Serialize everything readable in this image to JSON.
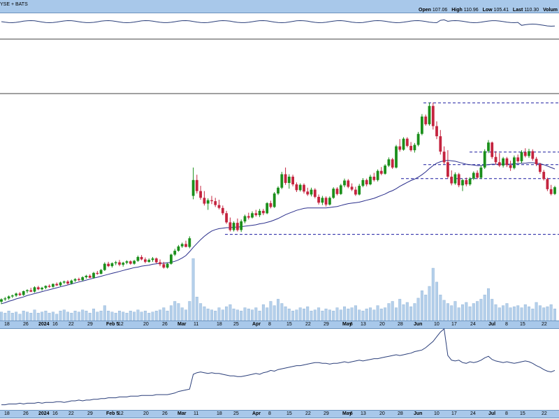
{
  "header": {
    "source": "YSE + BATS",
    "open_label": "Open",
    "open": "107.06",
    "high_label": "High",
    "high": "110.96",
    "low_label": "Low",
    "low": "105.41",
    "last_label": "Last",
    "last": "110.30",
    "volume_label": "Volum"
  },
  "axis_labels": [
    "18",
    "26",
    "2024",
    "16",
    "22",
    "29",
    "Feb 5",
    "12",
    "20",
    "26",
    "Mar",
    "11",
    "18",
    "25",
    "Apr",
    "8",
    "15",
    "22",
    "29",
    "May",
    "6",
    "13",
    "20",
    "28",
    "Jun",
    "10",
    "17",
    "24",
    "Jul",
    "8",
    "15",
    "22"
  ],
  "colors": {
    "up": "#1b8f1b",
    "down": "#c4243f",
    "sma": "#2b2f8c",
    "volume": "#b4cfea",
    "dashed": "#1a1aa0",
    "header": "#a8c8ea",
    "indicator": "#2b3f7a"
  },
  "chart_data": {
    "type": "candlestick",
    "ohlc_order": [
      "open",
      "high",
      "low",
      "close"
    ],
    "candles": [
      [
        69.6,
        70.3,
        69.1,
        70.1
      ],
      [
        70.1,
        70.6,
        69.8,
        70.3
      ],
      [
        70.3,
        70.9,
        70.0,
        70.7
      ],
      [
        70.7,
        71.1,
        70.4,
        70.9
      ],
      [
        70.9,
        71.5,
        70.6,
        71.3
      ],
      [
        71.3,
        71.6,
        70.8,
        71.0
      ],
      [
        71.0,
        71.9,
        70.8,
        71.8
      ],
      [
        71.8,
        72.2,
        71.4,
        72.0
      ],
      [
        72.0,
        72.5,
        71.6,
        71.7
      ],
      [
        71.7,
        72.8,
        71.5,
        72.6
      ],
      [
        72.6,
        72.9,
        72.0,
        72.2
      ],
      [
        72.2,
        72.7,
        71.9,
        72.5
      ],
      [
        72.5,
        73.0,
        72.2,
        72.9
      ],
      [
        72.9,
        73.2,
        72.5,
        72.7
      ],
      [
        72.7,
        73.4,
        72.5,
        73.3
      ],
      [
        73.3,
        73.6,
        72.9,
        73.0
      ],
      [
        73.0,
        73.8,
        72.8,
        73.6
      ],
      [
        73.6,
        74.0,
        73.3,
        73.8
      ],
      [
        73.8,
        74.1,
        73.1,
        73.4
      ],
      [
        73.4,
        74.2,
        73.2,
        74.0
      ],
      [
        74.0,
        74.5,
        73.7,
        74.3
      ],
      [
        74.3,
        74.6,
        73.9,
        74.1
      ],
      [
        74.1,
        74.9,
        73.9,
        74.7
      ],
      [
        74.7,
        75.2,
        74.4,
        75.0
      ],
      [
        75.0,
        75.3,
        74.5,
        74.6
      ],
      [
        74.6,
        75.8,
        74.4,
        75.6
      ],
      [
        75.6,
        76.0,
        75.2,
        75.4
      ],
      [
        75.4,
        76.4,
        75.3,
        76.2
      ],
      [
        76.2,
        77.8,
        76.0,
        77.5
      ],
      [
        77.5,
        77.9,
        76.8,
        77.0
      ],
      [
        77.0,
        77.8,
        76.7,
        77.6
      ],
      [
        77.6,
        78.1,
        77.2,
        77.8
      ],
      [
        77.8,
        78.3,
        77.0,
        77.3
      ],
      [
        77.3,
        77.9,
        76.9,
        77.7
      ],
      [
        77.7,
        78.2,
        77.4,
        78.0
      ],
      [
        78.0,
        78.2,
        77.3,
        77.5
      ],
      [
        77.5,
        78.3,
        77.3,
        78.1
      ],
      [
        78.1,
        79.2,
        77.9,
        78.9
      ],
      [
        78.9,
        79.3,
        78.2,
        78.4
      ],
      [
        78.4,
        78.8,
        77.6,
        77.9
      ],
      [
        77.9,
        78.6,
        77.7,
        78.3
      ],
      [
        78.3,
        78.9,
        77.9,
        78.6
      ],
      [
        78.6,
        78.8,
        77.6,
        77.8
      ],
      [
        77.8,
        78.4,
        77.0,
        77.4
      ],
      [
        77.4,
        77.9,
        76.5,
        76.7
      ],
      [
        76.7,
        77.7,
        76.5,
        77.5
      ],
      [
        77.5,
        79.6,
        77.3,
        79.4
      ],
      [
        79.4,
        80.6,
        79.1,
        80.2
      ],
      [
        80.2,
        81.4,
        80.0,
        81.1
      ],
      [
        81.1,
        81.9,
        80.8,
        81.6
      ],
      [
        81.6,
        82.3,
        80.9,
        81.0
      ],
      [
        81.0,
        83.2,
        80.7,
        82.8
      ],
      [
        91.6,
        97.5,
        90.9,
        94.9
      ],
      [
        94.9,
        96.0,
        92.1,
        92.6
      ],
      [
        92.6,
        93.7,
        90.8,
        91.2
      ],
      [
        91.2,
        92.6,
        89.6,
        90.0
      ],
      [
        90.0,
        91.1,
        88.7,
        90.7
      ],
      [
        90.7,
        91.6,
        89.9,
        90.5
      ],
      [
        90.5,
        91.2,
        89.3,
        89.7
      ],
      [
        89.7,
        90.8,
        88.8,
        89.1
      ],
      [
        89.1,
        89.6,
        87.6,
        88.0
      ],
      [
        88.0,
        88.5,
        85.8,
        86.1
      ],
      [
        86.1,
        87.1,
        84.2,
        84.5
      ],
      [
        84.5,
        86.3,
        84.2,
        86.0
      ],
      [
        86.0,
        86.9,
        84.2,
        84.5
      ],
      [
        84.5,
        86.7,
        84.1,
        86.3
      ],
      [
        86.3,
        87.7,
        85.9,
        87.4
      ],
      [
        87.4,
        88.1,
        86.7,
        87.1
      ],
      [
        87.1,
        88.4,
        86.9,
        88.0
      ],
      [
        88.0,
        88.7,
        87.3,
        87.6
      ],
      [
        87.6,
        88.9,
        87.2,
        88.5
      ],
      [
        88.5,
        88.9,
        87.6,
        88.0
      ],
      [
        88.0,
        90.3,
        87.8,
        90.1
      ],
      [
        90.1,
        90.6,
        89.0,
        89.3
      ],
      [
        89.3,
        92.4,
        89.1,
        92.1
      ],
      [
        92.1,
        93.6,
        91.8,
        93.3
      ],
      [
        93.3,
        96.6,
        93.0,
        96.1
      ],
      [
        96.1,
        97.5,
        93.9,
        94.3
      ],
      [
        94.3,
        96.1,
        93.1,
        95.6
      ],
      [
        95.6,
        96.0,
        93.6,
        94.0
      ],
      [
        94.0,
        94.4,
        92.4,
        92.8
      ],
      [
        92.8,
        94.2,
        92.5,
        93.9
      ],
      [
        93.9,
        94.2,
        92.1,
        92.5
      ],
      [
        92.5,
        93.3,
        91.6,
        91.9
      ],
      [
        91.9,
        93.3,
        91.5,
        92.9
      ],
      [
        92.9,
        93.2,
        91.1,
        91.4
      ],
      [
        91.4,
        91.9,
        89.8,
        90.2
      ],
      [
        90.2,
        91.6,
        89.7,
        91.2
      ],
      [
        91.2,
        91.5,
        89.4,
        89.8
      ],
      [
        89.8,
        91.5,
        89.6,
        91.2
      ],
      [
        91.2,
        93.4,
        91.0,
        93.1
      ],
      [
        93.1,
        93.4,
        91.7,
        92.0
      ],
      [
        92.0,
        94.1,
        91.8,
        93.8
      ],
      [
        93.8,
        95.2,
        93.4,
        94.8
      ],
      [
        94.8,
        95.1,
        93.2,
        93.5
      ],
      [
        93.5,
        94.2,
        92.6,
        92.9
      ],
      [
        92.9,
        93.5,
        91.6,
        91.9
      ],
      [
        91.9,
        94.1,
        91.7,
        93.7
      ],
      [
        93.7,
        95.3,
        93.4,
        94.9
      ],
      [
        94.9,
        95.2,
        93.6,
        94.0
      ],
      [
        94.0,
        96.0,
        93.8,
        95.6
      ],
      [
        95.6,
        96.4,
        94.6,
        94.9
      ],
      [
        94.9,
        97.1,
        94.6,
        96.8
      ],
      [
        96.8,
        97.6,
        95.9,
        96.2
      ],
      [
        96.2,
        98.2,
        96.0,
        97.9
      ],
      [
        97.9,
        99.6,
        97.6,
        99.2
      ],
      [
        99.2,
        99.5,
        97.2,
        97.5
      ],
      [
        97.5,
        102.2,
        97.3,
        101.9
      ],
      [
        101.9,
        103.4,
        100.8,
        101.2
      ],
      [
        101.2,
        103.8,
        101.0,
        103.5
      ],
      [
        103.5,
        103.8,
        101.7,
        102.0
      ],
      [
        102.0,
        102.8,
        100.8,
        101.1
      ],
      [
        101.1,
        102.6,
        100.6,
        102.2
      ],
      [
        102.2,
        104.9,
        101.9,
        104.5
      ],
      [
        104.5,
        108.6,
        104.2,
        108.1
      ],
      [
        108.1,
        108.5,
        106.2,
        106.5
      ],
      [
        106.5,
        111.0,
        106.2,
        110.3
      ],
      [
        110.3,
        111.0,
        105.4,
        106.1
      ],
      [
        106.1,
        107.1,
        103.4,
        104.0
      ],
      [
        104.0,
        105.3,
        100.2,
        100.8
      ],
      [
        100.8,
        101.9,
        98.2,
        98.6
      ],
      [
        98.6,
        101.1,
        95.2,
        95.6
      ],
      [
        95.6,
        96.9,
        93.8,
        94.2
      ],
      [
        94.2,
        96.5,
        93.9,
        96.1
      ],
      [
        96.1,
        96.4,
        93.4,
        93.8
      ],
      [
        93.8,
        95.1,
        92.6,
        94.9
      ],
      [
        94.9,
        95.4,
        93.6,
        94.0
      ],
      [
        94.0,
        95.5,
        93.7,
        95.2
      ],
      [
        95.2,
        96.7,
        94.9,
        96.4
      ],
      [
        96.4,
        96.9,
        95.1,
        95.4
      ],
      [
        95.4,
        97.9,
        95.1,
        97.5
      ],
      [
        97.5,
        101.3,
        97.2,
        100.9
      ],
      [
        100.9,
        103.2,
        100.5,
        102.7
      ],
      [
        102.7,
        102.9,
        99.3,
        99.7
      ],
      [
        99.7,
        100.9,
        98.1,
        98.6
      ],
      [
        98.6,
        100.5,
        97.6,
        97.9
      ],
      [
        97.9,
        99.7,
        97.5,
        99.4
      ],
      [
        99.4,
        99.7,
        97.6,
        98.0
      ],
      [
        98.0,
        98.9,
        96.8,
        97.4
      ],
      [
        97.4,
        100.0,
        97.1,
        99.6
      ],
      [
        99.6,
        100.2,
        98.5,
        98.8
      ],
      [
        98.8,
        101.1,
        98.4,
        100.7
      ],
      [
        100.7,
        101.5,
        99.6,
        99.9
      ],
      [
        99.9,
        101.4,
        99.5,
        100.9
      ],
      [
        100.9,
        101.3,
        98.9,
        99.3
      ],
      [
        99.3,
        99.7,
        97.8,
        98.2
      ],
      [
        98.2,
        98.5,
        96.2,
        96.6
      ],
      [
        96.6,
        97.0,
        94.8,
        95.1
      ],
      [
        95.1,
        95.4,
        92.6,
        93.0
      ],
      [
        93.0,
        93.9,
        91.7,
        92.0
      ],
      [
        92.0,
        93.7,
        91.8,
        93.4
      ]
    ],
    "sma": [
      69.2,
      69.4,
      69.7,
      69.9,
      70.2,
      70.4,
      70.6,
      70.9,
      71.1,
      71.3,
      71.5,
      71.7,
      71.9,
      72.1,
      72.3,
      72.5,
      72.7,
      72.9,
      73.1,
      73.3,
      73.5,
      73.7,
      73.9,
      74.1,
      74.3,
      74.5,
      74.7,
      74.9,
      75.1,
      75.3,
      75.5,
      75.7,
      75.9,
      76.1,
      76.3,
      76.5,
      76.7,
      76.8,
      77.0,
      77.1,
      77.2,
      77.4,
      77.5,
      77.6,
      77.6,
      77.7,
      77.8,
      78.0,
      78.3,
      78.7,
      79.2,
      80.0,
      80.9,
      81.7,
      82.5,
      83.2,
      83.8,
      84.3,
      84.6,
      84.8,
      84.9,
      85.0,
      85.0,
      85.1,
      85.1,
      85.2,
      85.3,
      85.4,
      85.5,
      85.6,
      85.8,
      85.9,
      86.1,
      86.3,
      86.6,
      86.9,
      87.3,
      87.7,
      88.0,
      88.3,
      88.6,
      88.8,
      89.0,
      89.1,
      89.1,
      89.1,
      89.1,
      89.1,
      89.1,
      89.2,
      89.3,
      89.4,
      89.6,
      89.8,
      90.0,
      90.1,
      90.2,
      90.3,
      90.5,
      90.7,
      90.9,
      91.1,
      91.4,
      91.7,
      92.0,
      92.4,
      92.7,
      93.1,
      93.6,
      94.0,
      94.4,
      94.8,
      95.1,
      95.5,
      96.0,
      96.6,
      97.3,
      97.9,
      98.4,
      98.7,
      98.9,
      99.0,
      98.9,
      98.8,
      98.6,
      98.4,
      98.2,
      98.1,
      98.0,
      97.9,
      97.9,
      98.0,
      98.1,
      98.2,
      98.2,
      98.2,
      98.2,
      98.2,
      98.2,
      98.3,
      98.3,
      98.4,
      98.4,
      98.5,
      98.5,
      98.4,
      98.3,
      98.1,
      97.8,
      97.5,
      97.2
    ],
    "volume": [
      8,
      7,
      9,
      7,
      8,
      6,
      9,
      8,
      7,
      10,
      7,
      8,
      9,
      7,
      8,
      6,
      9,
      10,
      8,
      7,
      9,
      8,
      10,
      9,
      7,
      11,
      8,
      9,
      14,
      9,
      8,
      7,
      9,
      8,
      7,
      9,
      8,
      10,
      8,
      9,
      7,
      8,
      9,
      10,
      12,
      9,
      14,
      18,
      16,
      12,
      10,
      18,
      58,
      22,
      16,
      13,
      11,
      10,
      9,
      12,
      10,
      13,
      15,
      11,
      10,
      9,
      12,
      11,
      10,
      12,
      9,
      15,
      12,
      18,
      14,
      20,
      16,
      13,
      11,
      9,
      10,
      12,
      11,
      13,
      9,
      10,
      12,
      9,
      11,
      10,
      9,
      12,
      10,
      13,
      11,
      12,
      14,
      10,
      9,
      11,
      12,
      10,
      14,
      11,
      12,
      16,
      18,
      12,
      20,
      15,
      17,
      13,
      16,
      21,
      28,
      24,
      32,
      49,
      36,
      24,
      19,
      16,
      14,
      18,
      12,
      15,
      17,
      13,
      16,
      18,
      20,
      24,
      30,
      20,
      15,
      12,
      14,
      16,
      12,
      13,
      14,
      12,
      15,
      13,
      11,
      17,
      14,
      12,
      13,
      15,
      11
    ],
    "indicator": [
      3,
      3,
      4,
      4,
      4,
      5,
      4,
      5,
      5,
      5,
      6,
      5,
      6,
      6,
      6,
      7,
      7,
      6,
      7,
      8,
      8,
      9,
      8,
      9,
      9,
      10,
      10,
      11,
      11,
      12,
      12,
      12,
      13,
      13,
      13,
      14,
      14,
      14,
      15,
      15,
      15,
      15,
      16,
      16,
      16,
      16,
      17,
      18,
      20,
      21,
      22,
      23,
      42,
      44,
      45,
      44,
      43,
      44,
      43,
      43,
      42,
      41,
      40,
      40,
      39,
      39,
      40,
      41,
      42,
      43,
      42,
      44,
      45,
      47,
      46,
      48,
      49,
      50,
      51,
      52,
      53,
      53,
      54,
      55,
      56,
      57,
      57,
      56,
      56,
      55,
      56,
      56,
      57,
      58,
      57,
      58,
      59,
      60,
      59,
      60,
      61,
      62,
      62,
      63,
      64,
      65,
      66,
      67,
      66,
      67,
      68,
      69,
      71,
      72,
      73,
      76,
      80,
      84,
      90,
      96,
      100,
      66,
      60,
      59,
      60,
      57,
      56,
      58,
      57,
      58,
      60,
      63,
      65,
      61,
      59,
      58,
      57,
      58,
      57,
      56,
      57,
      58,
      59,
      58,
      56,
      53,
      51,
      48,
      46,
      45,
      47
    ],
    "dashed_levels": [
      110.96,
      100.7,
      98.1,
      95.2,
      83.6
    ],
    "ylim": [
      67,
      112
    ]
  }
}
